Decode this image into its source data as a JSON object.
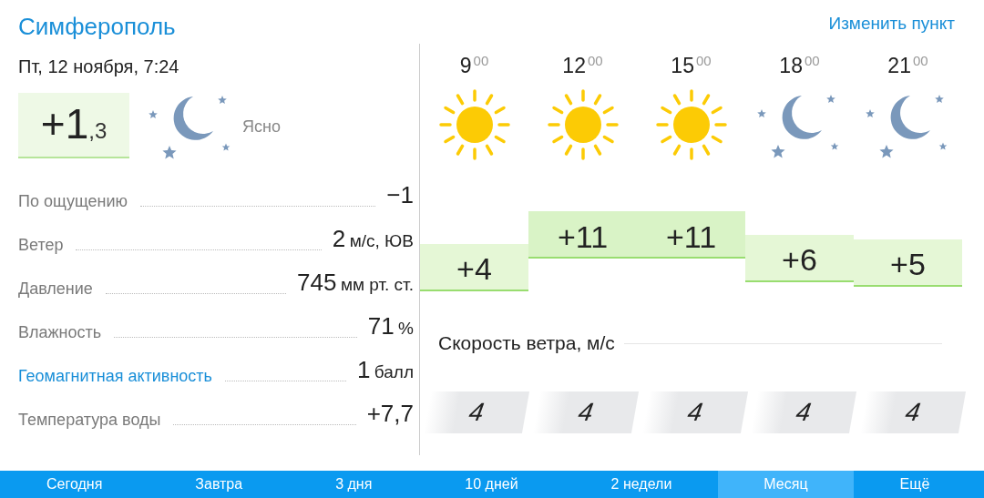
{
  "city": "Симферополь",
  "change_link": "Изменить пункт",
  "datetime": "Пт, 12 ноября, 7:24",
  "current": {
    "temp_whole": "+1",
    "temp_fraction": ",3",
    "condition": "Ясно",
    "kind": "moon"
  },
  "details": [
    {
      "label": "По ощущению",
      "value": "−1",
      "kind": "text"
    },
    {
      "label": "Ветер",
      "value": "2",
      "unit": "м/с, ЮВ",
      "kind": "text"
    },
    {
      "label": "Давление",
      "value": "745",
      "unit": "мм рт. ст.",
      "kind": "text"
    },
    {
      "label": "Влажность",
      "value": "71",
      "unit": "%",
      "kind": "text"
    },
    {
      "label": "Геомагнитная активность",
      "value": "1",
      "unit": "балл",
      "kind": "link"
    },
    {
      "label": "Температура воды",
      "value": "+7,7",
      "kind": "text"
    }
  ],
  "hours": [
    {
      "hour": "9",
      "minutes": "00",
      "kind": "sun",
      "temp": "+4",
      "wind": "4"
    },
    {
      "hour": "12",
      "minutes": "00",
      "kind": "sun",
      "temp": "+11",
      "wind": "4"
    },
    {
      "hour": "15",
      "minutes": "00",
      "kind": "sun",
      "temp": "+11",
      "wind": "4"
    },
    {
      "hour": "18",
      "minutes": "00",
      "kind": "moon",
      "temp": "+6",
      "wind": "4"
    },
    {
      "hour": "21",
      "minutes": "00",
      "kind": "moon",
      "temp": "+5",
      "wind": "4"
    }
  ],
  "wind_title": "Скорость ветра, м/с",
  "tabs": [
    {
      "label": "Сегодня",
      "selected": false
    },
    {
      "label": "Завтра",
      "selected": false
    },
    {
      "label": "3 дня",
      "selected": false
    },
    {
      "label": "10 дней",
      "selected": false
    },
    {
      "label": "2 недели",
      "selected": false
    },
    {
      "label": "Месяц",
      "selected": true
    },
    {
      "label": "Ещё",
      "selected": false
    }
  ]
}
